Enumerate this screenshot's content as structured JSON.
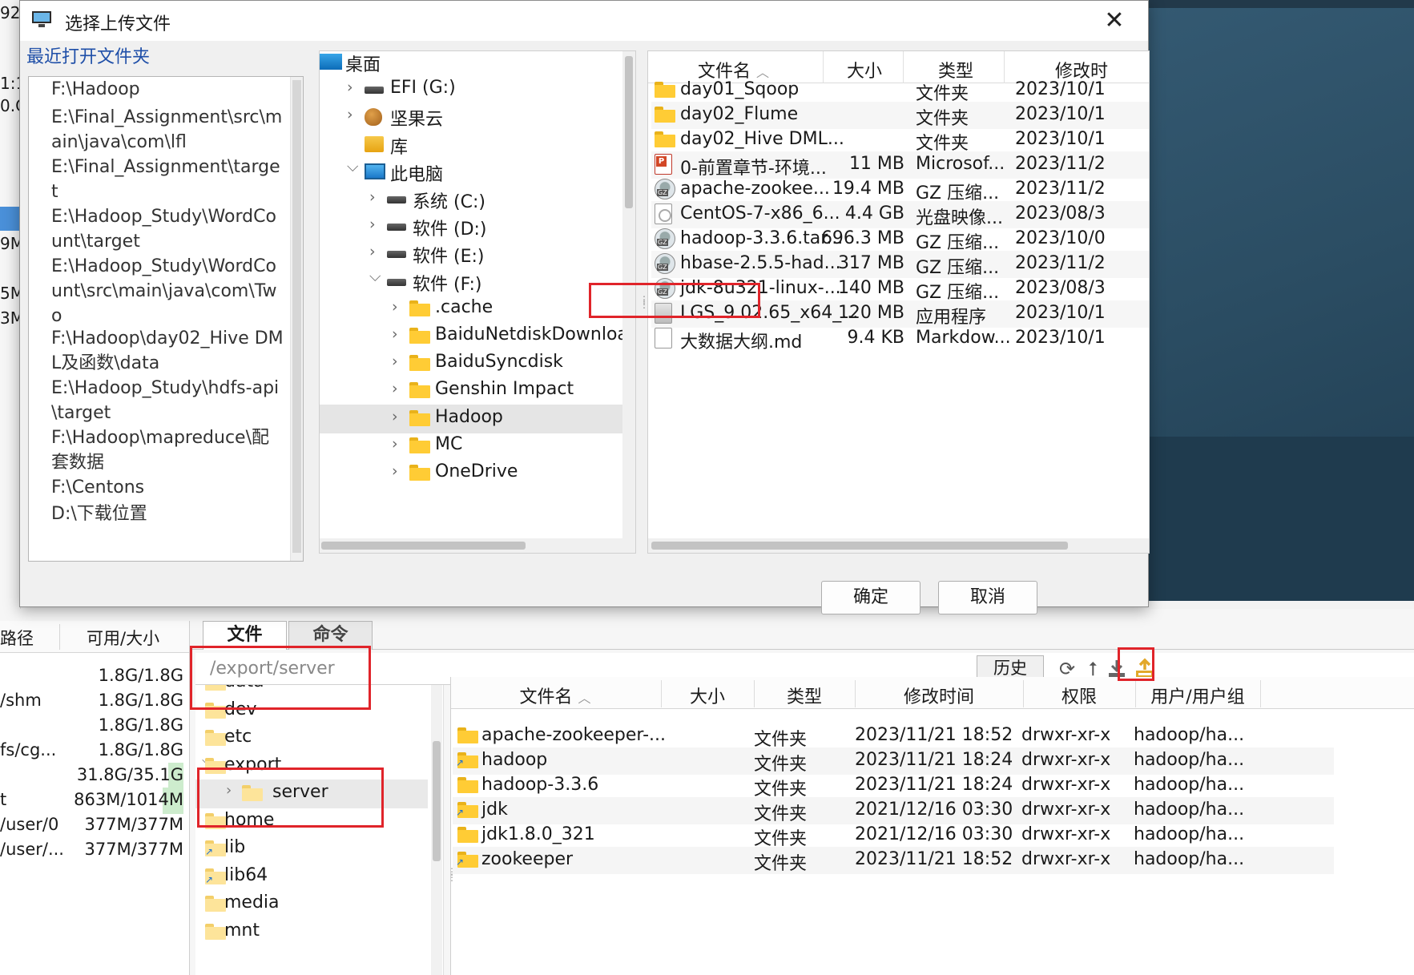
{
  "background": {
    "left_strip": [
      "92.",
      "1:1",
      "0.C",
      "9M",
      "5M",
      "3M"
    ],
    "tabs": [
      {
        "label": "文件",
        "active": true
      },
      {
        "label": "命令",
        "active": false
      }
    ],
    "disk_table": {
      "headers": {
        "path": "路径",
        "avail": "可用/大小"
      },
      "rows": [
        {
          "path": "",
          "avail": "1.8G/1.8G",
          "usage": 0.0
        },
        {
          "path": "/shm",
          "avail": "1.8G/1.8G",
          "usage": 0.0
        },
        {
          "path": "",
          "avail": "1.8G/1.8G",
          "usage": 0.0
        },
        {
          "path": "fs/cg...",
          "avail": "1.8G/1.8G",
          "usage": 0.0
        },
        {
          "path": "",
          "avail": "31.8G/35.1G",
          "usage": 0.09
        },
        {
          "path": "t",
          "avail": "863M/1014M",
          "usage": 0.15
        },
        {
          "path": "/user/0",
          "avail": "377M/377M",
          "usage": 0.0
        },
        {
          "path": "/user/...",
          "avail": "377M/377M",
          "usage": 0.0
        }
      ]
    },
    "path_bar": {
      "value": "/export/server",
      "history_label": "历史"
    },
    "toolbar_icons": [
      "refresh-icon",
      "go-up-icon",
      "download-icon",
      "upload-icon"
    ],
    "remote_tree": [
      {
        "label": "data",
        "level": 0,
        "expandable": false,
        "selected": false
      },
      {
        "label": "dev",
        "level": 0,
        "expandable": false,
        "selected": false
      },
      {
        "label": "etc",
        "level": 0,
        "expandable": false,
        "selected": false
      },
      {
        "label": "export",
        "level": 0,
        "expandable": true,
        "expanded": true,
        "selected": false
      },
      {
        "label": "server",
        "level": 1,
        "expandable": true,
        "expanded": false,
        "selected": true
      },
      {
        "label": "home",
        "level": 0,
        "expandable": false,
        "selected": false
      },
      {
        "label": "lib",
        "level": 0,
        "expandable": false,
        "selected": false,
        "link": true
      },
      {
        "label": "lib64",
        "level": 0,
        "expandable": false,
        "selected": false,
        "link": true
      },
      {
        "label": "media",
        "level": 0,
        "expandable": false,
        "selected": false
      },
      {
        "label": "mnt",
        "level": 0,
        "expandable": false,
        "selected": false
      }
    ],
    "remote_list": {
      "headers": {
        "name": "文件名",
        "size": "大小",
        "type": "类型",
        "mtime": "修改时间",
        "perm": "权限",
        "owner": "用户/用户组"
      },
      "rows": [
        {
          "name": "apache-zookeeper-...",
          "size": "",
          "type": "文件夹",
          "mtime": "2023/11/21 18:52",
          "perm": "drwxr-xr-x",
          "owner": "hadoop/ha...",
          "link": false
        },
        {
          "name": "hadoop",
          "size": "",
          "type": "文件夹",
          "mtime": "2023/11/21 18:24",
          "perm": "drwxr-xr-x",
          "owner": "hadoop/ha...",
          "link": true
        },
        {
          "name": "hadoop-3.3.6",
          "size": "",
          "type": "文件夹",
          "mtime": "2023/11/21 18:24",
          "perm": "drwxr-xr-x",
          "owner": "hadoop/ha...",
          "link": false
        },
        {
          "name": "jdk",
          "size": "",
          "type": "文件夹",
          "mtime": "2021/12/16 03:30",
          "perm": "drwxr-xr-x",
          "owner": "hadoop/ha...",
          "link": true
        },
        {
          "name": "jdk1.8.0_321",
          "size": "",
          "type": "文件夹",
          "mtime": "2021/12/16 03:30",
          "perm": "drwxr-xr-x",
          "owner": "hadoop/ha...",
          "link": false
        },
        {
          "name": "zookeeper",
          "size": "",
          "type": "文件夹",
          "mtime": "2023/11/21 18:52",
          "perm": "drwxr-xr-x",
          "owner": "hadoop/ha...",
          "link": true
        }
      ]
    }
  },
  "dialog": {
    "title": "选择上传文件",
    "close_glyph": "✕",
    "recent_label": "最近打开文件夹",
    "recent_folders": [
      "F:\\Hadoop",
      "E:\\Final_Assignment\\src\\main\\java\\com\\lfl",
      "E:\\Final_Assignment\\target",
      "E:\\Hadoop_Study\\WordCount\\target",
      "E:\\Hadoop_Study\\WordCount\\src\\main\\java\\com\\Two",
      "F:\\Hadoop\\day02_Hive DML及函数\\data",
      "E:\\Hadoop_Study\\hdfs-api\\target",
      "F:\\Hadoop\\mapreduce\\配套数据",
      "F:\\Centons",
      "D:\\下载位置"
    ],
    "folder_tree": [
      {
        "label": "桌面",
        "level": 0,
        "icon": "desktop-icon",
        "chevron": "none"
      },
      {
        "label": "EFI (G:)",
        "level": 1,
        "icon": "drive-icon",
        "chevron": "right"
      },
      {
        "label": "坚果云",
        "level": 1,
        "icon": "nutstore-icon",
        "chevron": "right"
      },
      {
        "label": "库",
        "level": 1,
        "icon": "library-icon",
        "chevron": "none"
      },
      {
        "label": "此电脑",
        "level": 1,
        "icon": "computer-icon",
        "chevron": "down"
      },
      {
        "label": "系统 (C:)",
        "level": 2,
        "icon": "drive-icon",
        "chevron": "right"
      },
      {
        "label": "软件 (D:)",
        "level": 2,
        "icon": "drive-icon",
        "chevron": "right"
      },
      {
        "label": "软件 (E:)",
        "level": 2,
        "icon": "drive-icon",
        "chevron": "right"
      },
      {
        "label": "软件 (F:)",
        "level": 2,
        "icon": "drive-icon",
        "chevron": "down"
      },
      {
        "label": ".cache",
        "level": 3,
        "icon": "folder-icon",
        "chevron": "right"
      },
      {
        "label": "BaiduNetdiskDownload",
        "level": 3,
        "icon": "folder-icon",
        "chevron": "right"
      },
      {
        "label": "BaiduSyncdisk",
        "level": 3,
        "icon": "folder-icon",
        "chevron": "right"
      },
      {
        "label": "Genshin Impact",
        "level": 3,
        "icon": "folder-icon",
        "chevron": "right"
      },
      {
        "label": "Hadoop",
        "level": 3,
        "icon": "folder-icon",
        "chevron": "right",
        "selected": true
      },
      {
        "label": "MC",
        "level": 3,
        "icon": "folder-icon",
        "chevron": "right"
      },
      {
        "label": "OneDrive",
        "level": 3,
        "icon": "folder-icon",
        "chevron": "right"
      }
    ],
    "file_list": {
      "headers": {
        "name": "文件名",
        "size": "大小",
        "type": "类型",
        "mtime": "修改时"
      },
      "rows": [
        {
          "name": "day01_Sqoop",
          "size": "",
          "type": "文件夹",
          "mtime": "2023/10/1",
          "icon": "folder"
        },
        {
          "name": "day02_Flume",
          "size": "",
          "type": "文件夹",
          "mtime": "2023/10/1",
          "icon": "folder"
        },
        {
          "name": "day02_Hive DML...",
          "size": "",
          "type": "文件夹",
          "mtime": "2023/10/1",
          "icon": "folder"
        },
        {
          "name": "0-前置章节-环境...",
          "size": "11 MB",
          "type": "Microsof...",
          "mtime": "2023/11/2",
          "icon": "ppt"
        },
        {
          "name": "apache-zookee...",
          "size": "19.4 MB",
          "type": "GZ 压缩...",
          "mtime": "2023/11/2",
          "icon": "gz"
        },
        {
          "name": "CentOS-7-x86_6...",
          "size": "4.4 GB",
          "type": "光盘映像...",
          "mtime": "2023/08/3",
          "icon": "iso"
        },
        {
          "name": "hadoop-3.3.6.tar...",
          "size": "696.3 MB",
          "type": "GZ 压缩...",
          "mtime": "2023/10/0",
          "icon": "gz"
        },
        {
          "name": "hbase-2.5.5-had...",
          "size": "317 MB",
          "type": "GZ 压缩...",
          "mtime": "2023/11/2",
          "icon": "gz",
          "highlighted": true
        },
        {
          "name": "jdk-8u321-linux-...",
          "size": "140 MB",
          "type": "GZ 压缩...",
          "mtime": "2023/08/3",
          "icon": "gz"
        },
        {
          "name": "LGS_9.02.65_x64_...",
          "size": "120 MB",
          "type": "应用程序",
          "mtime": "2023/10/1",
          "icon": "exe"
        },
        {
          "name": "大数据大纲.md",
          "size": "9.4 KB",
          "type": "Markdow...",
          "mtime": "2023/10/1",
          "icon": "file"
        }
      ]
    },
    "buttons": {
      "ok": "确定",
      "cancel": "取消"
    }
  }
}
